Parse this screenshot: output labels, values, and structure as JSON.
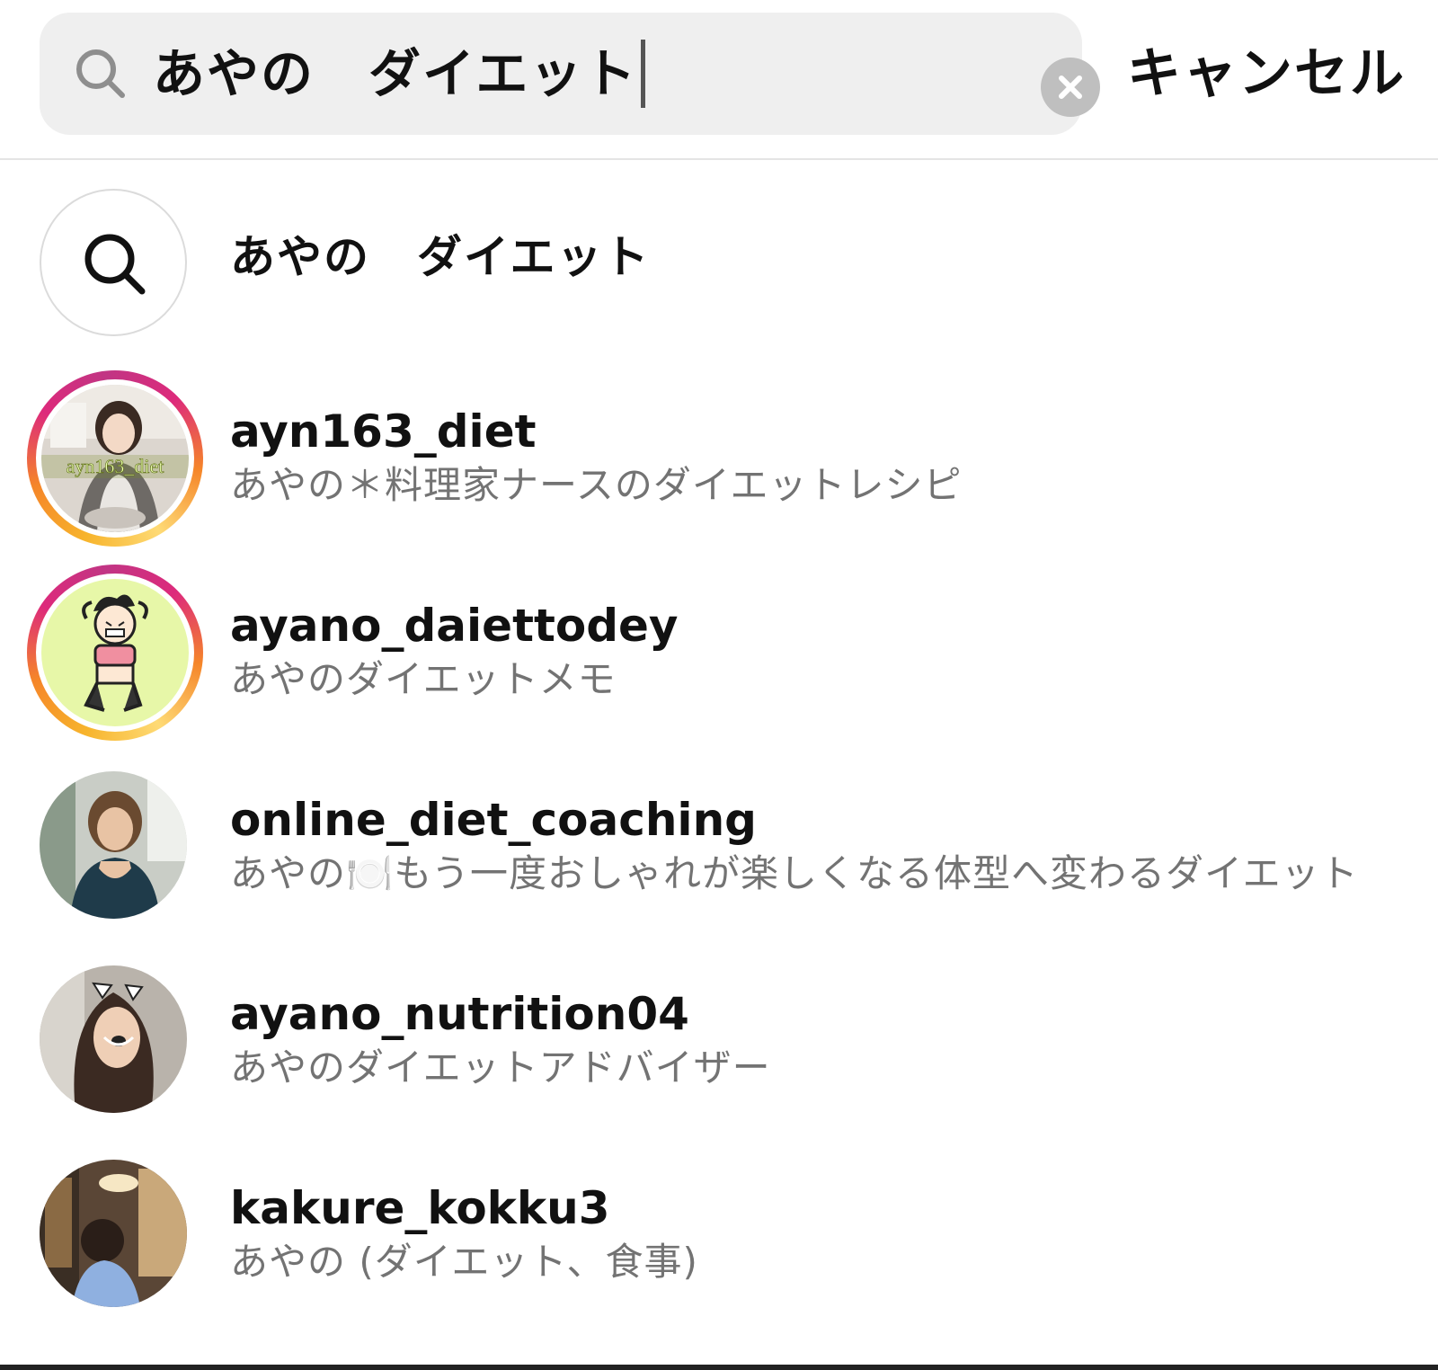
{
  "search": {
    "query": "あやの　ダイエット",
    "cancel_label": "キャンセル"
  },
  "suggestion": {
    "text": "あやの　ダイエット"
  },
  "results": [
    {
      "username": "ayn163_diet",
      "full_name": "あやの＊料理家ナースのダイエットレシピ",
      "avatar_caption": "ayn163_diet",
      "has_story": true
    },
    {
      "username": "ayano_daiettodey",
      "full_name": "あやのダイエットメモ",
      "has_story": true
    },
    {
      "username": "online_diet_coaching",
      "full_name": "あやの🍽️もう一度おしゃれが楽しくなる体型へ変わるダイエット",
      "has_story": false
    },
    {
      "username": "ayano_nutrition04",
      "full_name": "あやのダイエットアドバイザー",
      "has_story": false
    },
    {
      "username": "kakure_kokku3",
      "full_name": "あやの (ダイエット、食事)",
      "has_story": false
    }
  ],
  "colors": {
    "story_ring": [
      "#feda75",
      "#f58529",
      "#dd2a7b",
      "#c13584"
    ],
    "secondary_text": "#737373",
    "search_bg": "#efefef"
  }
}
